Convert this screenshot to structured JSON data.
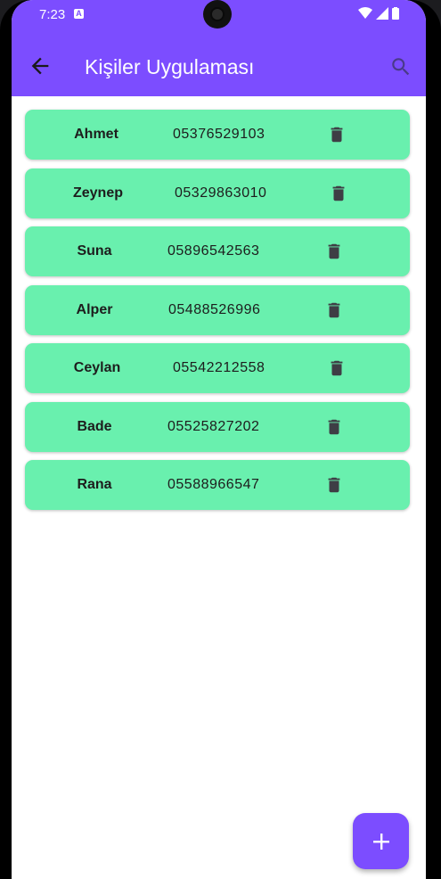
{
  "status": {
    "time": "7:23",
    "notification_icon": "A"
  },
  "appbar": {
    "title": "Kişiler Uygulaması",
    "back_icon": "arrow-back-icon",
    "search_icon": "search-icon",
    "color": "#7c4dff"
  },
  "contacts": [
    {
      "name": "Ahmet",
      "phone": "05376529103"
    },
    {
      "name": "Zeynep",
      "phone": "05329863010"
    },
    {
      "name": "Suna",
      "phone": "05896542563"
    },
    {
      "name": "Alper",
      "phone": "05488526996"
    },
    {
      "name": "Ceylan",
      "phone": "05542212558"
    },
    {
      "name": "Bade",
      "phone": "05525827202"
    },
    {
      "name": "Rana",
      "phone": "05588966547"
    }
  ],
  "card_color": "#69f0ae",
  "fab": {
    "icon": "plus-icon"
  }
}
